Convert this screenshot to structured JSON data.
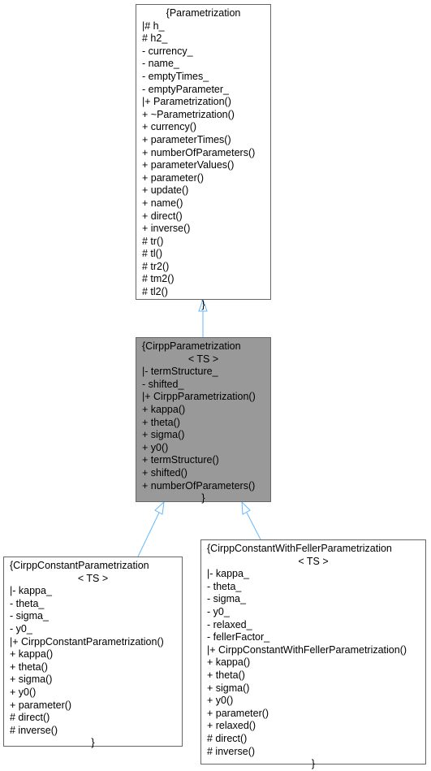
{
  "diagram": {
    "type": "class-inheritance",
    "edge_color": "#63b8ff",
    "highlight_color": "#999999",
    "classes": [
      {
        "id": "parametrization",
        "title_lines": [
          "{Parametrization"
        ],
        "members": [
          "|# h_",
          "# h2_",
          "- currency_",
          "- name_",
          "- emptyTimes_",
          "- emptyParameter_",
          "|+ Parametrization()",
          "+ ~Parametrization()",
          "+ currency()",
          "+ parameterTimes()",
          "+ numberOfParameters()",
          "+ parameterValues()",
          "+ parameter()",
          "+ update()",
          "+ name()",
          "+ direct()",
          "+ inverse()",
          "# tr()",
          "# tl()",
          "# tr2()",
          "# tm2()",
          "# tl2()"
        ],
        "closing": "}"
      },
      {
        "id": "cirpp-parametrization",
        "title_lines": [
          "{CirppParametrization",
          "< TS >"
        ],
        "members": [
          "|- termStructure_",
          "- shifted_",
          "|+ CirppParametrization()",
          "+ kappa()",
          "+ theta()",
          "+ sigma()",
          "+ y0()",
          "+ termStructure()",
          "+ shifted()",
          "+ numberOfParameters()"
        ],
        "closing": "}"
      },
      {
        "id": "cirpp-constant-parametrization",
        "title_lines": [
          "{CirppConstantParametrization",
          "< TS >"
        ],
        "members": [
          "|- kappa_",
          "- theta_",
          "- sigma_",
          "- y0_",
          "|+ CirppConstantParametrization()",
          "+ kappa()",
          "+ theta()",
          "+ sigma()",
          "+ y0()",
          "+ parameter()",
          "# direct()",
          "# inverse()"
        ],
        "closing": "}"
      },
      {
        "id": "cirpp-constant-with-feller-parametrization",
        "title_lines": [
          "{CirppConstantWithFellerParametrization",
          "< TS >"
        ],
        "members": [
          "|- kappa_",
          "- theta_",
          "- sigma_",
          "- y0_",
          "- relaxed_",
          "- fellerFactor_",
          "|+ CirppConstantWithFellerParametrization()",
          "+ kappa()",
          "+ theta()",
          "+ sigma()",
          "+ y0()",
          "+ parameter()",
          "+ relaxed()",
          "# direct()",
          "# inverse()"
        ],
        "closing": "}"
      }
    ],
    "edges": [
      {
        "from": "cirpp-parametrization",
        "to": "parametrization",
        "kind": "inheritance"
      },
      {
        "from": "cirpp-constant-parametrization",
        "to": "cirpp-parametrization",
        "kind": "inheritance"
      },
      {
        "from": "cirpp-constant-with-feller-parametrization",
        "to": "cirpp-parametrization",
        "kind": "inheritance"
      }
    ]
  }
}
